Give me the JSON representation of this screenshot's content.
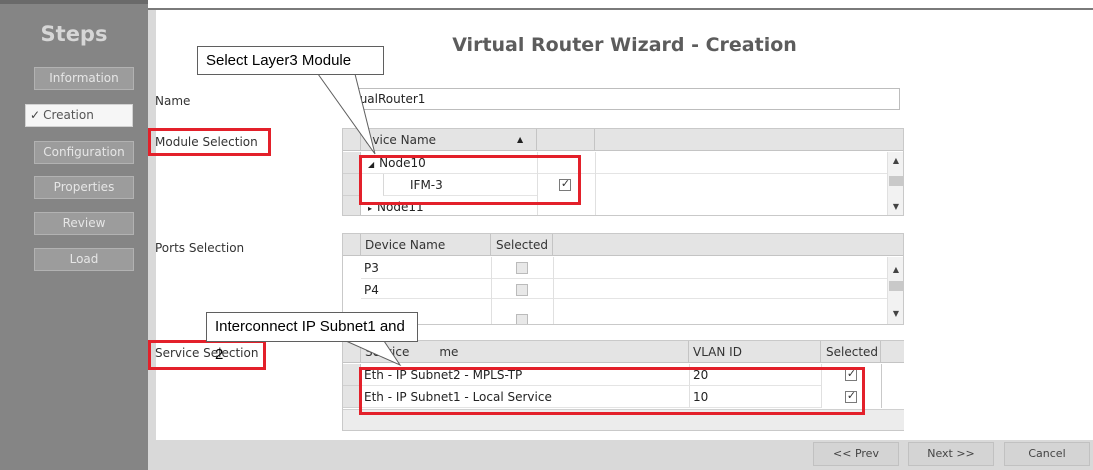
{
  "sidebar": {
    "title": "Steps",
    "items": [
      {
        "label": "Information"
      },
      {
        "label": "Creation",
        "check": "✓"
      },
      {
        "label": "Configuration"
      },
      {
        "label": "Properties"
      },
      {
        "label": "Review"
      },
      {
        "label": "Load"
      }
    ]
  },
  "wizard": {
    "title": "Virtual Router Wizard - Creation",
    "name_label": "Name",
    "name_value": "tualRouter1",
    "module_label": "Module Selection",
    "ports_label": "Ports Selection",
    "service_label": "Service Selection"
  },
  "module_grid": {
    "headers": [
      "evice Name",
      ""
    ],
    "sort_icon": "sort-ascending-icon",
    "rows": [
      {
        "expander": "◢",
        "name": "Node10"
      },
      {
        "name": "IFM-3",
        "selected": true
      },
      {
        "expander": "▸",
        "name": "Node11"
      }
    ]
  },
  "ports_grid": {
    "headers": [
      "Device Name",
      "Selected"
    ],
    "rows": [
      {
        "name": "P3",
        "selected": false
      },
      {
        "name": "P4",
        "selected": false
      },
      {
        "name": "",
        "selected": false
      }
    ]
  },
  "service_grid": {
    "headers": [
      "Service",
      "me",
      "VLAN ID",
      "Selected"
    ],
    "rows": [
      {
        "name": "Eth - IP Subnet2 - MPLS-TP",
        "vlan": "20",
        "selected": true
      },
      {
        "name": "Eth - IP Subnet1 - Local Service",
        "vlan": "10",
        "selected": true
      }
    ]
  },
  "callouts": {
    "layer3": "Select Layer3 Module",
    "interconnect": "Interconnect IP Subnet1 and 2"
  },
  "footer": {
    "prev": "<< Prev",
    "next": "Next >>",
    "cancel": "Cancel"
  },
  "colors": {
    "highlight": "#e3202a",
    "sidebar_bg": "#858585"
  }
}
